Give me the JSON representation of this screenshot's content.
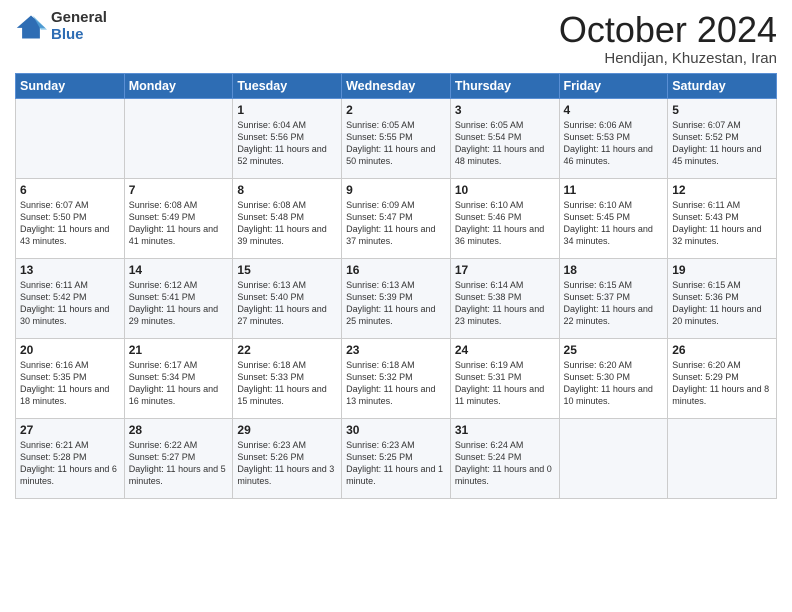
{
  "logo": {
    "general": "General",
    "blue": "Blue"
  },
  "header": {
    "month": "October 2024",
    "location": "Hendijan, Khuzestan, Iran"
  },
  "weekdays": [
    "Sunday",
    "Monday",
    "Tuesday",
    "Wednesday",
    "Thursday",
    "Friday",
    "Saturday"
  ],
  "weeks": [
    [
      {
        "day": "",
        "content": ""
      },
      {
        "day": "",
        "content": ""
      },
      {
        "day": "1",
        "content": "Sunrise: 6:04 AM\nSunset: 5:56 PM\nDaylight: 11 hours and 52 minutes."
      },
      {
        "day": "2",
        "content": "Sunrise: 6:05 AM\nSunset: 5:55 PM\nDaylight: 11 hours and 50 minutes."
      },
      {
        "day": "3",
        "content": "Sunrise: 6:05 AM\nSunset: 5:54 PM\nDaylight: 11 hours and 48 minutes."
      },
      {
        "day": "4",
        "content": "Sunrise: 6:06 AM\nSunset: 5:53 PM\nDaylight: 11 hours and 46 minutes."
      },
      {
        "day": "5",
        "content": "Sunrise: 6:07 AM\nSunset: 5:52 PM\nDaylight: 11 hours and 45 minutes."
      }
    ],
    [
      {
        "day": "6",
        "content": "Sunrise: 6:07 AM\nSunset: 5:50 PM\nDaylight: 11 hours and 43 minutes."
      },
      {
        "day": "7",
        "content": "Sunrise: 6:08 AM\nSunset: 5:49 PM\nDaylight: 11 hours and 41 minutes."
      },
      {
        "day": "8",
        "content": "Sunrise: 6:08 AM\nSunset: 5:48 PM\nDaylight: 11 hours and 39 minutes."
      },
      {
        "day": "9",
        "content": "Sunrise: 6:09 AM\nSunset: 5:47 PM\nDaylight: 11 hours and 37 minutes."
      },
      {
        "day": "10",
        "content": "Sunrise: 6:10 AM\nSunset: 5:46 PM\nDaylight: 11 hours and 36 minutes."
      },
      {
        "day": "11",
        "content": "Sunrise: 6:10 AM\nSunset: 5:45 PM\nDaylight: 11 hours and 34 minutes."
      },
      {
        "day": "12",
        "content": "Sunrise: 6:11 AM\nSunset: 5:43 PM\nDaylight: 11 hours and 32 minutes."
      }
    ],
    [
      {
        "day": "13",
        "content": "Sunrise: 6:11 AM\nSunset: 5:42 PM\nDaylight: 11 hours and 30 minutes."
      },
      {
        "day": "14",
        "content": "Sunrise: 6:12 AM\nSunset: 5:41 PM\nDaylight: 11 hours and 29 minutes."
      },
      {
        "day": "15",
        "content": "Sunrise: 6:13 AM\nSunset: 5:40 PM\nDaylight: 11 hours and 27 minutes."
      },
      {
        "day": "16",
        "content": "Sunrise: 6:13 AM\nSunset: 5:39 PM\nDaylight: 11 hours and 25 minutes."
      },
      {
        "day": "17",
        "content": "Sunrise: 6:14 AM\nSunset: 5:38 PM\nDaylight: 11 hours and 23 minutes."
      },
      {
        "day": "18",
        "content": "Sunrise: 6:15 AM\nSunset: 5:37 PM\nDaylight: 11 hours and 22 minutes."
      },
      {
        "day": "19",
        "content": "Sunrise: 6:15 AM\nSunset: 5:36 PM\nDaylight: 11 hours and 20 minutes."
      }
    ],
    [
      {
        "day": "20",
        "content": "Sunrise: 6:16 AM\nSunset: 5:35 PM\nDaylight: 11 hours and 18 minutes."
      },
      {
        "day": "21",
        "content": "Sunrise: 6:17 AM\nSunset: 5:34 PM\nDaylight: 11 hours and 16 minutes."
      },
      {
        "day": "22",
        "content": "Sunrise: 6:18 AM\nSunset: 5:33 PM\nDaylight: 11 hours and 15 minutes."
      },
      {
        "day": "23",
        "content": "Sunrise: 6:18 AM\nSunset: 5:32 PM\nDaylight: 11 hours and 13 minutes."
      },
      {
        "day": "24",
        "content": "Sunrise: 6:19 AM\nSunset: 5:31 PM\nDaylight: 11 hours and 11 minutes."
      },
      {
        "day": "25",
        "content": "Sunrise: 6:20 AM\nSunset: 5:30 PM\nDaylight: 11 hours and 10 minutes."
      },
      {
        "day": "26",
        "content": "Sunrise: 6:20 AM\nSunset: 5:29 PM\nDaylight: 11 hours and 8 minutes."
      }
    ],
    [
      {
        "day": "27",
        "content": "Sunrise: 6:21 AM\nSunset: 5:28 PM\nDaylight: 11 hours and 6 minutes."
      },
      {
        "day": "28",
        "content": "Sunrise: 6:22 AM\nSunset: 5:27 PM\nDaylight: 11 hours and 5 minutes."
      },
      {
        "day": "29",
        "content": "Sunrise: 6:23 AM\nSunset: 5:26 PM\nDaylight: 11 hours and 3 minutes."
      },
      {
        "day": "30",
        "content": "Sunrise: 6:23 AM\nSunset: 5:25 PM\nDaylight: 11 hours and 1 minute."
      },
      {
        "day": "31",
        "content": "Sunrise: 6:24 AM\nSunset: 5:24 PM\nDaylight: 11 hours and 0 minutes."
      },
      {
        "day": "",
        "content": ""
      },
      {
        "day": "",
        "content": ""
      }
    ]
  ]
}
